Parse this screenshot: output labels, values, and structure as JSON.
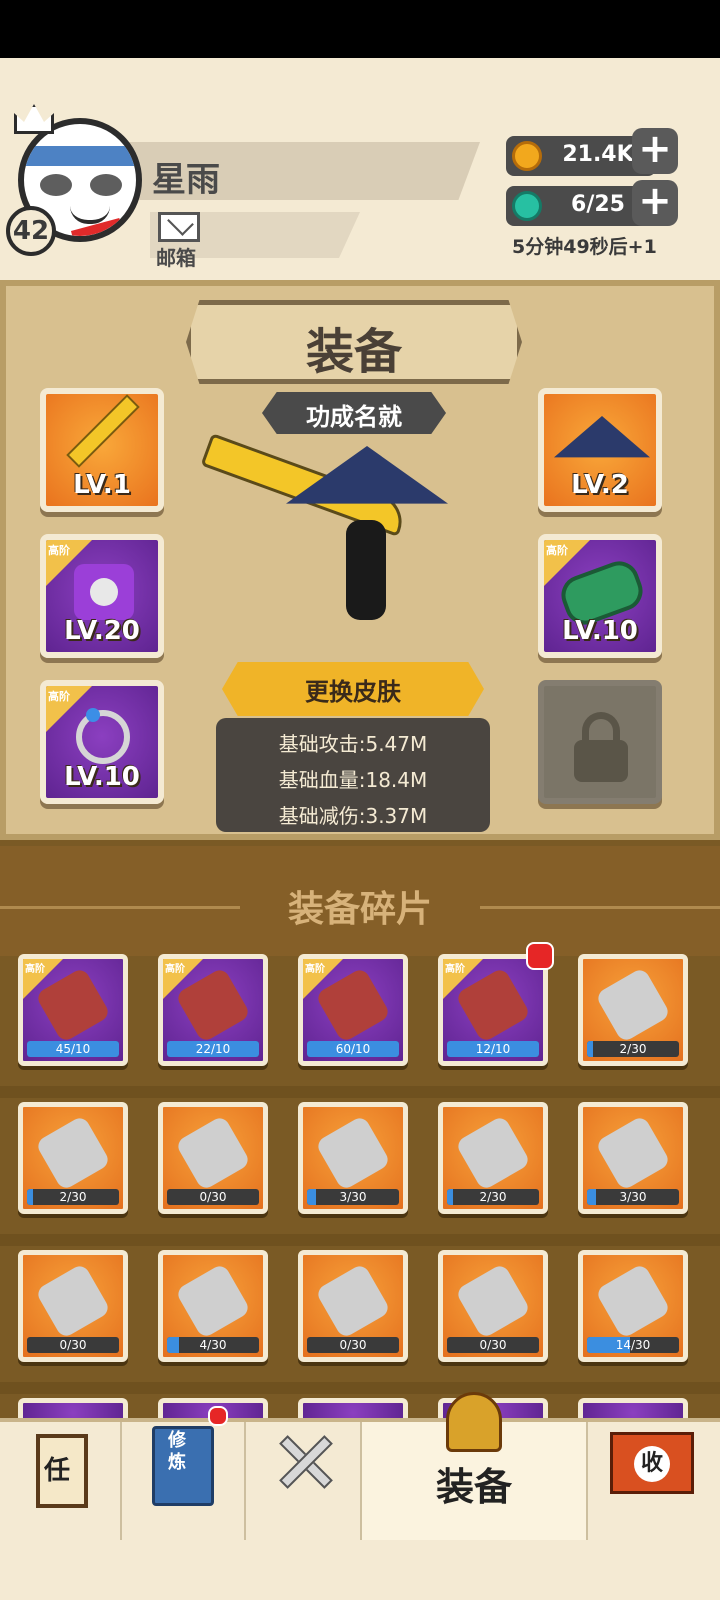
{
  "player": {
    "name": "星雨",
    "level": "42",
    "mail_label": "邮箱"
  },
  "resources": {
    "coins": {
      "value": "21.4K",
      "icon": "coin-icon",
      "color": "#f2a81d"
    },
    "stamina": {
      "value": "6/25",
      "icon": "gem-icon",
      "color": "#27c0a2"
    },
    "timer": "5分钟49秒后+1"
  },
  "equip": {
    "title": "装备",
    "subtitle": "功成名就",
    "change_skin": "更换皮肤",
    "stats": [
      "基础攻击:5.47M",
      "基础血量:18.4M",
      "基础减伤:3.37M"
    ],
    "slots_left": [
      {
        "level": "LV.1",
        "rarity": "",
        "item": "sword-icon",
        "bg": "orange"
      },
      {
        "level": "LV.20",
        "rarity": "高阶",
        "item": "armor-icon",
        "bg": "purple"
      },
      {
        "level": "LV.10",
        "rarity": "高阶",
        "item": "ring-icon",
        "bg": "purple"
      }
    ],
    "slots_right": [
      {
        "level": "LV.2",
        "rarity": "",
        "item": "hat-icon",
        "bg": "orange"
      },
      {
        "level": "LV.10",
        "rarity": "高阶",
        "item": "bracer-icon",
        "bg": "purple"
      },
      {
        "level": "",
        "rarity": "",
        "item": "lock-icon",
        "bg": "locked"
      }
    ]
  },
  "fragments": {
    "title": "装备碎片",
    "items": [
      {
        "progress": "45/10",
        "fill": 1.0,
        "rarity": "高阶",
        "bg": "purple",
        "item": "gauntlet-icon",
        "badge": false
      },
      {
        "progress": "22/10",
        "fill": 1.0,
        "rarity": "高阶",
        "bg": "purple",
        "item": "sword-icon",
        "badge": false
      },
      {
        "progress": "60/10",
        "fill": 1.0,
        "rarity": "高阶",
        "bg": "purple",
        "item": "hat-icon",
        "badge": false
      },
      {
        "progress": "12/10",
        "fill": 1.0,
        "rarity": "高阶",
        "bg": "purple",
        "item": "armor-icon",
        "badge": true
      },
      {
        "progress": "2/30",
        "fill": 0.07,
        "rarity": "",
        "bg": "orange",
        "item": "sword-icon",
        "badge": false
      },
      {
        "progress": "2/30",
        "fill": 0.07,
        "rarity": "",
        "bg": "orange",
        "item": "mace-icon",
        "badge": false
      },
      {
        "progress": "0/30",
        "fill": 0.0,
        "rarity": "",
        "bg": "orange",
        "item": "flail-icon",
        "badge": false
      },
      {
        "progress": "3/30",
        "fill": 0.1,
        "rarity": "",
        "bg": "orange",
        "item": "staff-icon",
        "badge": false
      },
      {
        "progress": "2/30",
        "fill": 0.07,
        "rarity": "",
        "bg": "orange",
        "item": "spear-icon",
        "badge": false
      },
      {
        "progress": "3/30",
        "fill": 0.1,
        "rarity": "",
        "bg": "orange",
        "item": "blade-icon",
        "badge": false
      },
      {
        "progress": "0/30",
        "fill": 0.0,
        "rarity": "",
        "bg": "orange",
        "item": "mask-icon",
        "badge": false
      },
      {
        "progress": "4/30",
        "fill": 0.13,
        "rarity": "",
        "bg": "orange",
        "item": "key-icon",
        "badge": false
      },
      {
        "progress": "0/30",
        "fill": 0.0,
        "rarity": "",
        "bg": "orange",
        "item": "hat-icon",
        "badge": false
      },
      {
        "progress": "0/30",
        "fill": 0.0,
        "rarity": "",
        "bg": "orange",
        "item": "shirt-icon",
        "badge": false
      },
      {
        "progress": "14/30",
        "fill": 0.47,
        "rarity": "",
        "bg": "orange",
        "item": "armor-icon",
        "badge": false
      }
    ]
  },
  "nav": {
    "tasks_label": "任",
    "practice_label": "修炼",
    "battle_icon": "crossed-swords-icon",
    "equip_label": "装备",
    "collect_label": "收"
  }
}
